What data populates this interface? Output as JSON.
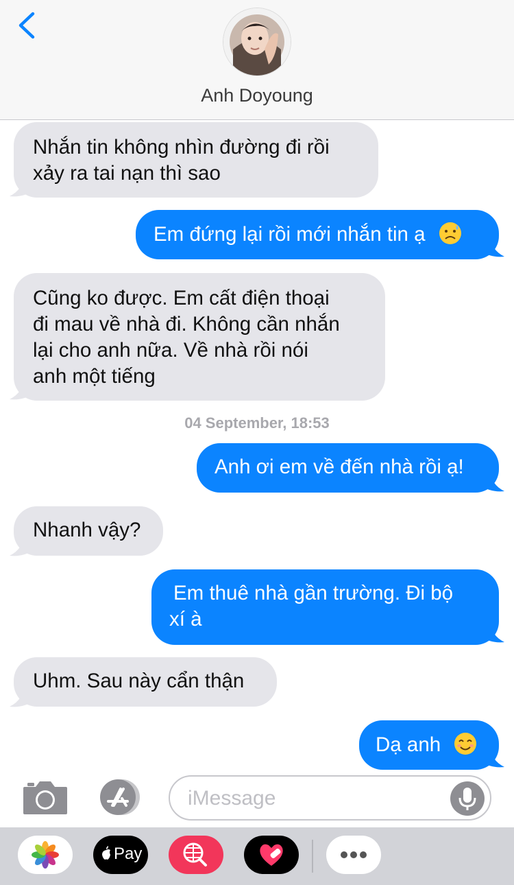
{
  "header": {
    "contact_name": "Anh Doyoung"
  },
  "messages": [
    {
      "from": "contact",
      "lines": [
        "Nhắn tin không nhìn đường đi rồi",
        "xảy ra tai nạn thì sao"
      ]
    },
    {
      "from": "me",
      "text": "Em đứng lại rồi mới nhắn tin ạ",
      "emoji": "sad-sweat-emoji"
    },
    {
      "from": "contact",
      "lines": [
        "Cũng ko được. Em cất điện thoại",
        "đi mau về nhà đi. Không cần nhắn",
        "lại cho anh nữa. Về nhà rồi nói",
        "anh một tiếng"
      ]
    },
    {
      "from": "me",
      "text": "Anh ơi em về đến nhà rồi ạ!"
    },
    {
      "from": "contact",
      "text": "Nhanh vậy?"
    },
    {
      "from": "me",
      "lines": [
        "Em thuê nhà gần trường. Đi bộ",
        "xí à"
      ]
    },
    {
      "from": "contact",
      "text": "Uhm. Sau này cẩn thận"
    },
    {
      "from": "me",
      "text": "Dạ anh",
      "emoji": "smiling-face-emoji"
    }
  ],
  "timestamp": "04 September, 18:53",
  "input": {
    "placeholder": "iMessage"
  },
  "drawer": {
    "apps": [
      "photos-app",
      "apple-pay-app",
      "web-image-search-app",
      "digital-touch-app",
      "more-apps"
    ],
    "pay_label": "Pay"
  },
  "colors": {
    "outgoing": "#0b84ff",
    "incoming": "#e5e5ea",
    "header_bg": "#f7f7f7",
    "drawer_bg": "#d2d3d8"
  }
}
